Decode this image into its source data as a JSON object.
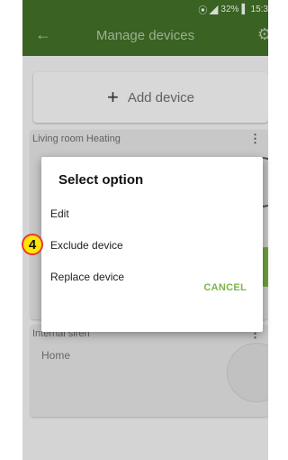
{
  "status_bar": {
    "signal": "⦿ ◢",
    "battery_percent": "32%",
    "battery_icon": "▌",
    "time": "15:3"
  },
  "app_bar": {
    "back": "←",
    "title": "Manage devices",
    "settings": "⚙"
  },
  "add_device": {
    "icon": "+",
    "label": "Add device"
  },
  "cards": [
    {
      "title": "Living room Heating",
      "menu": "⋮"
    },
    {
      "title": "Internal siren",
      "menu": "⋮",
      "mode": "Home"
    }
  ],
  "dialog": {
    "title": "Select option",
    "options": [
      "Edit",
      "Exclude device",
      "Replace device"
    ],
    "cancel": "CANCEL"
  },
  "step_marker": "4",
  "colors": {
    "app_bar": "#3f6b25",
    "accent": "#7ab648",
    "marker_fill": "#ffe600",
    "marker_ring": "#e53935"
  }
}
